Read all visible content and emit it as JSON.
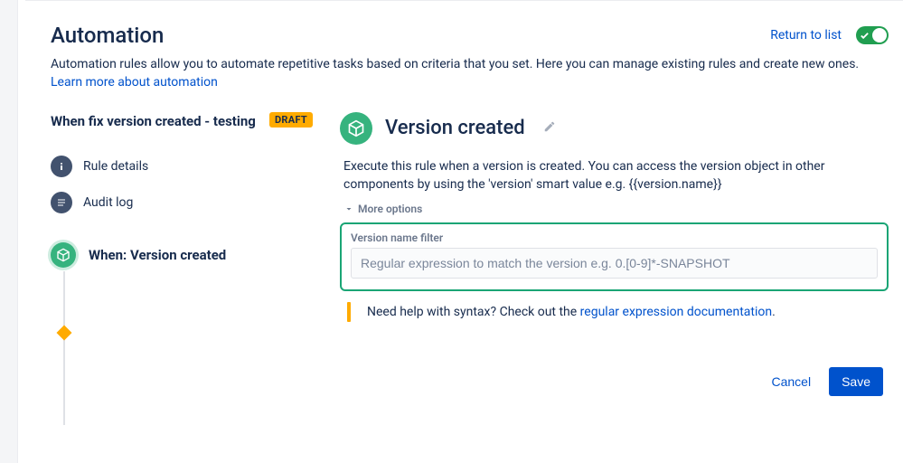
{
  "header": {
    "title": "Automation",
    "return_link": "Return to list",
    "desc": "Automation rules allow you to automate repetitive tasks based on criteria that you set. Here you can manage existing rules and create new ones. ",
    "learn_more": "Learn more about automation"
  },
  "rule": {
    "name": "When fix version created - testing",
    "status_badge": "DRAFT"
  },
  "nav": {
    "details": "Rule details",
    "audit": "Audit log"
  },
  "timeline": {
    "when_label": "When: Version created"
  },
  "section": {
    "title": "Version created",
    "desc": "Execute this rule when a version is created. You can access the version object in other components by using the 'version' smart value e.g. {{version.name}}",
    "more_options": "More options",
    "field_label": "Version name filter",
    "field_placeholder": "Regular expression to match the version e.g. 0.[0-9]*-SNAPSHOT",
    "help_prefix": "Need help with syntax? Check out the ",
    "help_link": "regular expression documentation",
    "help_suffix": "."
  },
  "actions": {
    "cancel": "Cancel",
    "save": "Save"
  }
}
